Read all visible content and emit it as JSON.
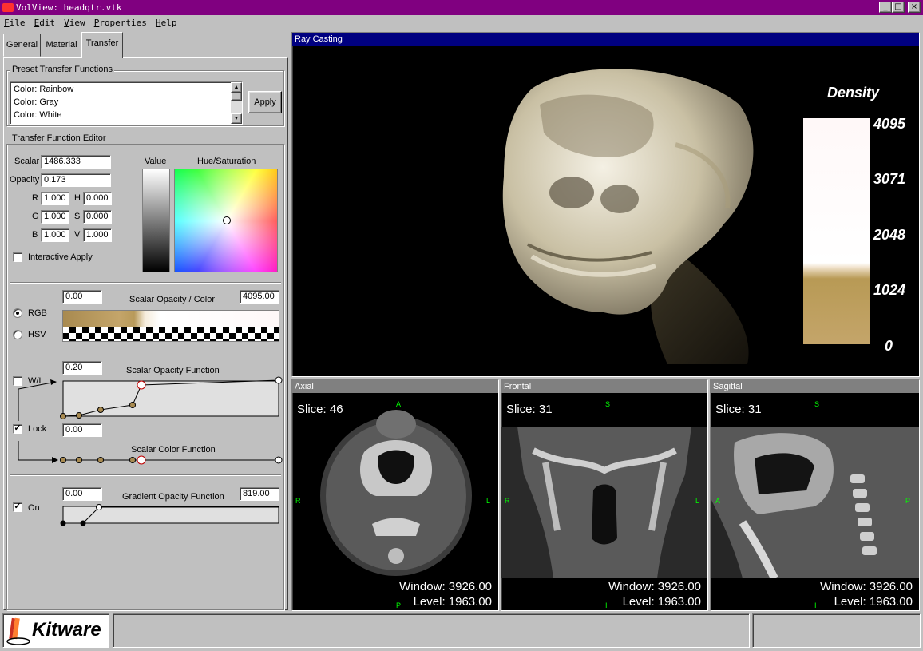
{
  "window": {
    "title": "VolView: headqtr.vtk",
    "controls": {
      "minimize": "_",
      "maximize": "□",
      "close": "×"
    }
  },
  "menu": [
    "File",
    "Edit",
    "View",
    "Properties",
    "Help"
  ],
  "tabs": [
    {
      "label": "General",
      "active": false
    },
    {
      "label": "Material",
      "active": false
    },
    {
      "label": "Transfer",
      "active": true
    }
  ],
  "preset": {
    "title": "Preset Transfer Functions",
    "items": [
      "Color:  Rainbow",
      "Color:  Gray",
      "Color:  White"
    ],
    "apply_label": "Apply"
  },
  "editor": {
    "title": "Transfer Function Editor",
    "scalar_label": "Scalar",
    "scalar_value": "1486.333",
    "opacity_label": "Opacity",
    "opacity_value": "0.173",
    "r_label": "R",
    "r_value": "1.000",
    "g_label": "G",
    "g_value": "1.000",
    "b_label": "B",
    "b_value": "1.000",
    "h_label": "H",
    "h_value": "0.000",
    "s_label": "S",
    "s_value": "0.000",
    "v_label": "V",
    "v_value": "1.000",
    "value_label": "Value",
    "hue_sat_label": "Hue/Saturation",
    "interactive_apply_label": "Interactive Apply",
    "interactive_apply_checked": false
  },
  "scalar_opacity_color": {
    "min": "0.00",
    "max": "4095.00",
    "title": "Scalar Opacity / Color",
    "rgb_label": "RGB",
    "hsv_label": "HSV",
    "mode": "RGB"
  },
  "scalar_opacity_function": {
    "value": "0.20",
    "title": "Scalar Opacity Function",
    "wl_label": "W/L",
    "wl_checked": false
  },
  "lock": {
    "label": "Lock",
    "checked": true,
    "value": "0.00"
  },
  "scalar_color_function": {
    "title": "Scalar Color Function"
  },
  "gradient": {
    "on_label": "On",
    "on_checked": true,
    "min": "0.00",
    "max": "819.00",
    "title": "Gradient Opacity Function"
  },
  "render_view": {
    "title": "Ray Casting",
    "legend_title": "Density",
    "legend_ticks": [
      "4095",
      "3071",
      "2048",
      "1024",
      "0"
    ]
  },
  "slice_views": [
    {
      "title": "Axial",
      "slice": "Slice: 46",
      "top": "A",
      "bottom": "P",
      "left": "R",
      "right": "L",
      "window": "Window: 3926.00",
      "level": "Level: 1963.00"
    },
    {
      "title": "Frontal",
      "slice": "Slice: 31",
      "top": "S",
      "bottom": "I",
      "left": "R",
      "right": "L",
      "window": "Window: 3926.00",
      "level": "Level: 1963.00"
    },
    {
      "title": "Sagittal",
      "slice": "Slice: 31",
      "top": "S",
      "bottom": "I",
      "left": "A",
      "right": "P",
      "window": "Window: 3926.00",
      "level": "Level: 1963.00"
    }
  ],
  "status": {
    "logo_text": "Kitware"
  }
}
